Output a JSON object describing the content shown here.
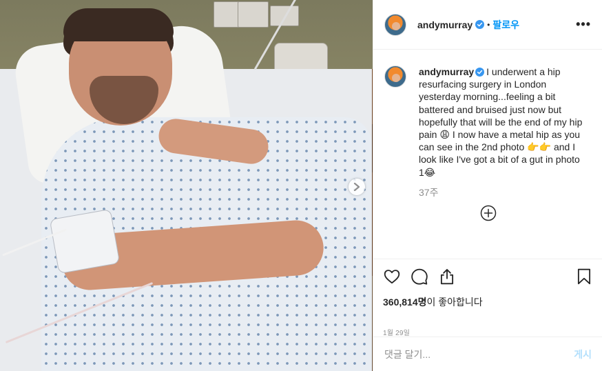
{
  "photo": {
    "alt": "Patient in hospital bed wearing a gown"
  },
  "header": {
    "username": "andymurray",
    "separator": "•",
    "follow_label": "팔로우",
    "more_label": "•••"
  },
  "caption": {
    "username": "andymurray",
    "text": "I underwent a hip resurfacing surgery in London yesterday morning...feeling a bit battered and bruised just now but hopefully that will be the end of my hip pain 😩 I now have a metal hip as you can see in the 2nd photo 👉👉 and I look like I've got a bit of a gut in photo 1😂",
    "time_ago": "37주"
  },
  "stats": {
    "likes_count": "360,814명",
    "likes_suffix": "이 좋아합니다",
    "date": "1월 29일"
  },
  "comment_box": {
    "placeholder": "댓글 달기...",
    "post_label": "게시"
  },
  "colors": {
    "accent": "#0095f6",
    "post_disabled": "#b2dffc",
    "muted": "#8e8e8e",
    "text": "#262626"
  }
}
